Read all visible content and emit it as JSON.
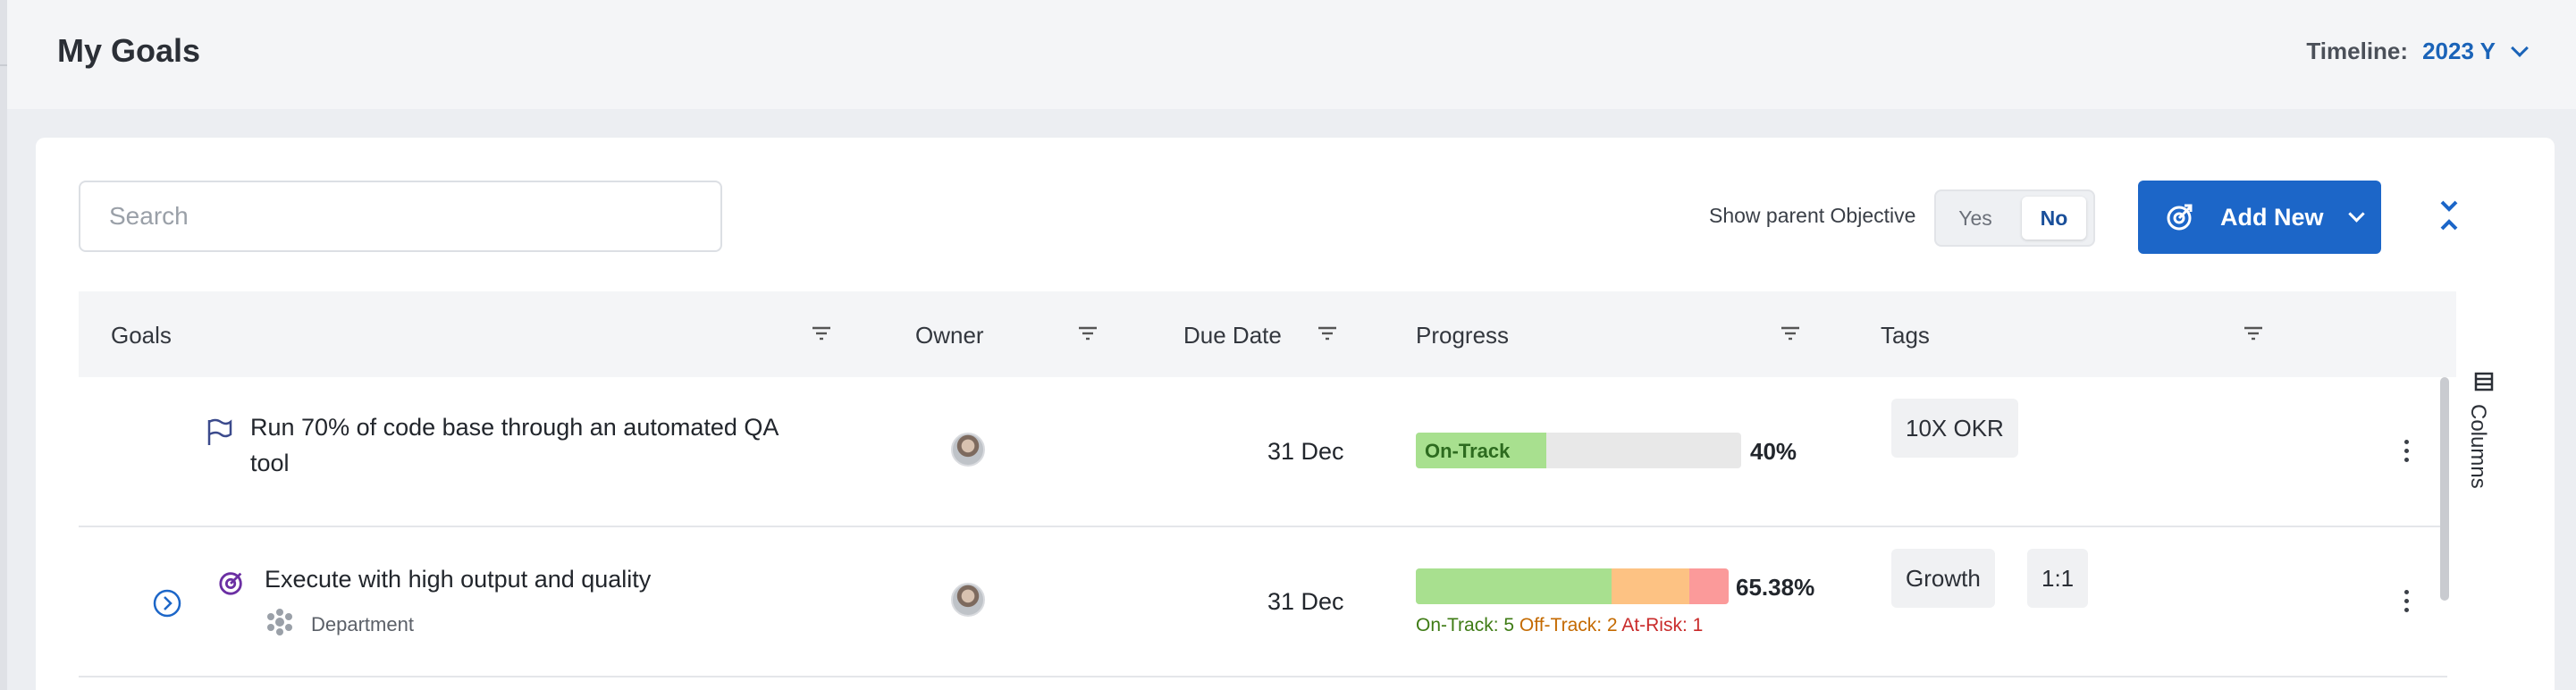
{
  "header": {
    "title": "My Goals",
    "timeline_label": "Timeline:",
    "timeline_value": "2023 Y"
  },
  "toolbar": {
    "search_placeholder": "Search",
    "show_parent_label": "Show parent Objective",
    "toggle_yes": "Yes",
    "toggle_no": "No",
    "toggle_selected": "No",
    "add_new_label": "Add New"
  },
  "table": {
    "columns": [
      "Goals",
      "Owner",
      "Due Date",
      "Progress",
      "Tags"
    ],
    "side_label": "Columns",
    "rows": [
      {
        "goal": "Run 70% of code base through an automated QA tool",
        "due": "31 Dec",
        "status": "On-Track",
        "progress_fraction": 0.4,
        "progress_text": "40%",
        "tags": [
          "10X OKR"
        ]
      },
      {
        "goal": "Execute with high output and quality",
        "sub_label": "Department",
        "due": "31 Dec",
        "segments": [
          {
            "label": "On-Track",
            "count": 5,
            "color": "#a8e08f"
          },
          {
            "label": "Off-Track",
            "count": 2,
            "color": "#fdc283"
          },
          {
            "label": "At-Risk",
            "count": 1,
            "color": "#fb9a9a"
          }
        ],
        "legend": [
          "On-Track: 5",
          "Off-Track: 2",
          "At-Risk: 1"
        ],
        "progress_text": "65.38%",
        "tags": [
          "Growth",
          "1:1"
        ]
      }
    ]
  },
  "colors": {
    "accent": "#1c66c8",
    "on_track": "#a8e08f",
    "off_track": "#fdc283",
    "at_risk": "#fb9a9a"
  }
}
